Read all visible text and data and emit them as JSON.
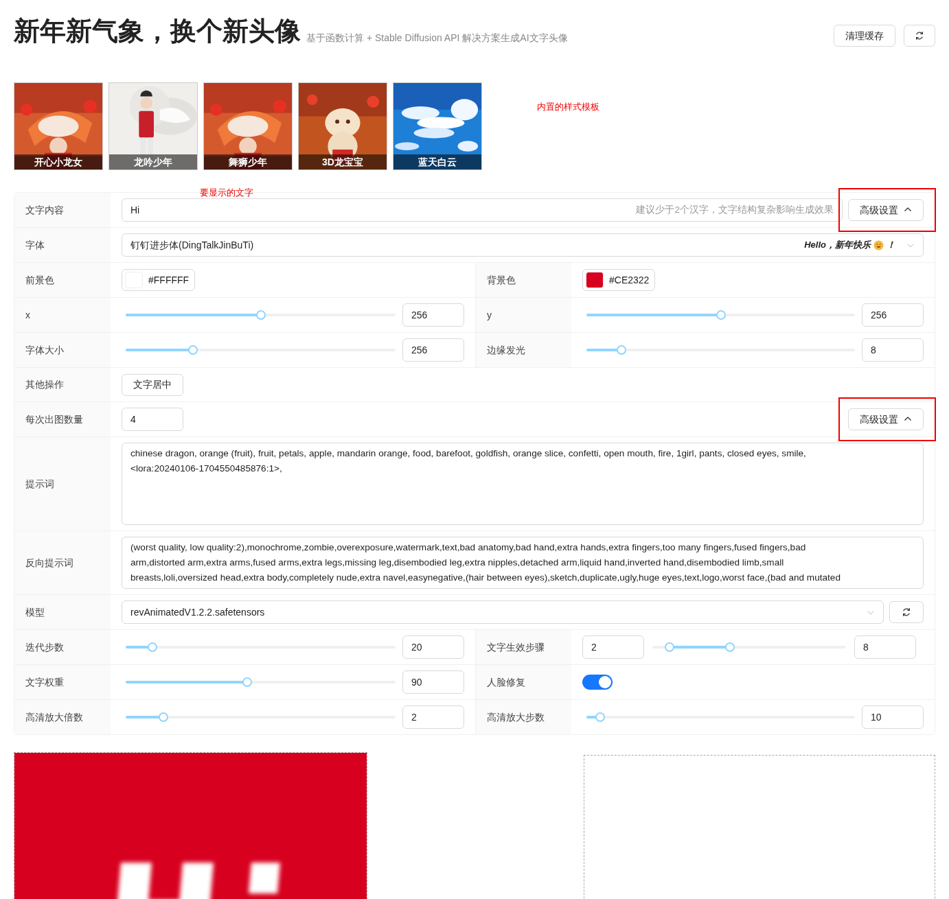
{
  "header": {
    "title": "新年新气象，换个新头像",
    "subtitle": "基于函数计算 + Stable Diffusion API 解决方案生成AI文字头像",
    "buttons": [
      {
        "kind": "text",
        "label": "清理缓存"
      },
      {
        "kind": "refresh"
      }
    ]
  },
  "templates": {
    "note": "内置的样式模板",
    "items": [
      {
        "caption": "开心小龙女",
        "kind": "festive"
      },
      {
        "caption": "龙吟少年",
        "kind": "white"
      },
      {
        "caption": "舞狮少年",
        "kind": "festive"
      },
      {
        "caption": "3D龙宝宝",
        "kind": "warm"
      },
      {
        "caption": "蓝天白云",
        "kind": "sky"
      }
    ]
  },
  "form": {
    "note": "要显示的文字",
    "rows": [
      {
        "kind": "text",
        "label": "文字内容",
        "value": "Hi",
        "hint": "建议少于2个汉字，文字结构复杂影响生成效果",
        "button": {
          "label": "高级设置",
          "highlighted": true
        }
      },
      {
        "kind": "select",
        "label": "字体",
        "value": "钉钉进步体(DingTalkJinBuTi)",
        "preview_before": "Hello，新年快乐",
        "preview_after": "！"
      },
      {
        "kind": "pair",
        "cells": [
          {
            "kind": "color",
            "label": "前景色",
            "value": "#FFFFFF",
            "color": "#ffffff"
          },
          {
            "kind": "color",
            "label": "背景色",
            "value": "#CE2322",
            "color": "#d7001e"
          }
        ]
      },
      {
        "kind": "pair",
        "cells": [
          {
            "kind": "slider",
            "label": "x",
            "level": 0.5,
            "value": "256"
          },
          {
            "kind": "slider",
            "label": "y",
            "level": 0.5,
            "value": "256"
          }
        ]
      },
      {
        "kind": "pair",
        "cells": [
          {
            "kind": "slider",
            "label": "字体大小",
            "level": 0.25,
            "value": "256"
          },
          {
            "kind": "slider",
            "label": "边缘发光",
            "level": 0.13,
            "value": "8"
          }
        ]
      },
      {
        "kind": "buttons",
        "label": "其他操作",
        "buttons": [
          "文字居中"
        ]
      },
      {
        "kind": "number",
        "label": "每次出图数量",
        "value": "4",
        "button": {
          "label": "高级设置",
          "highlighted": true
        }
      },
      {
        "kind": "textarea",
        "label": "提示词",
        "lines": [
          "chinese dragon, orange (fruit), fruit, petals, apple, mandarin orange, food, barefoot, goldfish, orange slice, confetti, open mouth, fire, 1girl, pants, closed eyes, smile,",
          "<lora:20240106-1704550485876:1>,"
        ]
      },
      {
        "kind": "textarea",
        "label": "反向提示词",
        "lines": [
          "(worst quality, low quality:2),monochrome,zombie,overexposure,watermark,text,bad anatomy,bad hand,extra hands,extra fingers,too many fingers,fused fingers,bad",
          "arm,distorted arm,extra arms,fused arms,extra legs,missing leg,disembodied leg,extra nipples,detached arm,liquid hand,inverted hand,disembodied limb,small",
          "breasts,loli,oversized head,extra body,completely nude,extra navel,easynegative,(hair between eyes),sketch,duplicate,ugly,huge eyes,text,logo,worst face,(bad and mutated"
        ]
      },
      {
        "kind": "model",
        "label": "模型",
        "value": "revAnimatedV1.2.2.safetensors"
      },
      {
        "kind": "pair",
        "cells": [
          {
            "kind": "slider",
            "label": "迭代步数",
            "level": 0.1,
            "value": "20"
          },
          {
            "kind": "range",
            "label": "文字生效步骤",
            "min": "2",
            "max": "8",
            "start": {
              "level": 0.09
            },
            "end": {
              "level": 0.4
            }
          }
        ]
      },
      {
        "kind": "pair",
        "cells": [
          {
            "kind": "slider",
            "label": "文字权重",
            "level": 0.45,
            "value": "90"
          },
          {
            "kind": "toggle",
            "label": "人脸修复",
            "on": true
          }
        ]
      },
      {
        "kind": "pair",
        "cells": [
          {
            "kind": "slider",
            "label": "高清放大倍数",
            "level": 0.14,
            "value": "2"
          },
          {
            "kind": "slider",
            "label": "高清放大步数",
            "level": 0.05,
            "value": "10"
          }
        ]
      }
    ]
  },
  "results": [
    {
      "kind": "picture"
    },
    {
      "kind": "empty"
    }
  ]
}
